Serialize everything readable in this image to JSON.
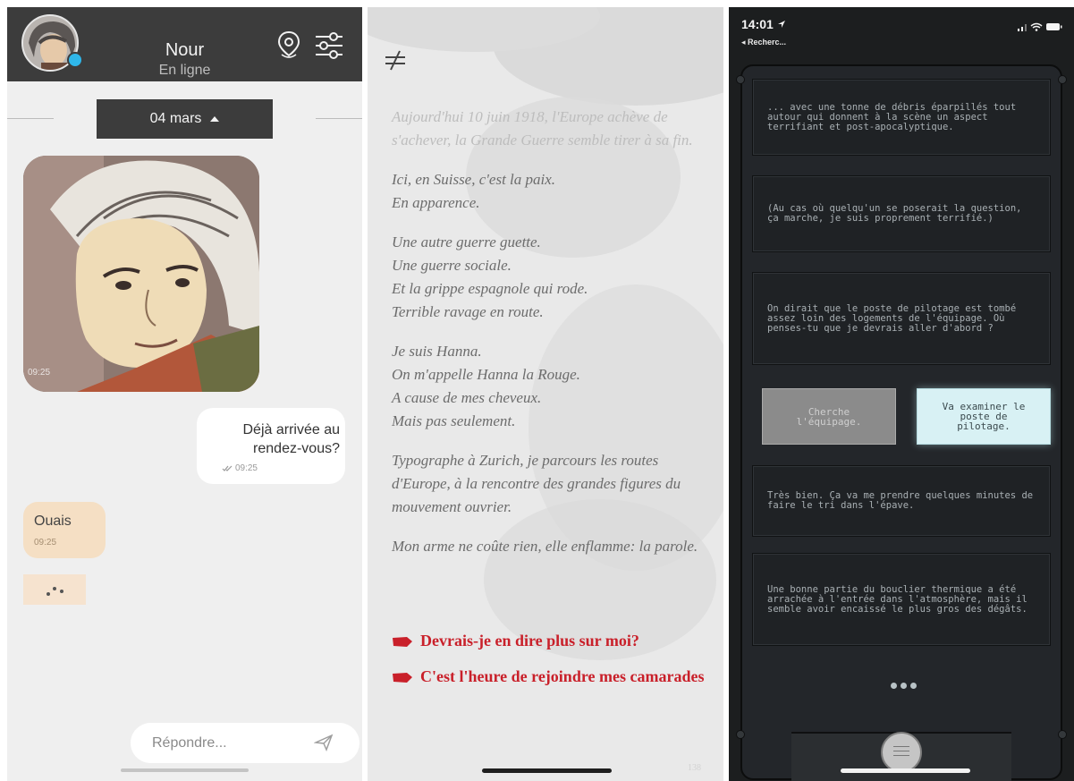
{
  "chat": {
    "contact_name": "Nour",
    "contact_status": "En ligne",
    "date_label": "04 mars",
    "photo_time": "09:25",
    "messages": [
      {
        "text": "Déjà arrivée au rendez-vous?",
        "time": "09:25"
      },
      {
        "text": "Ouais",
        "time": "09:25"
      }
    ],
    "reply_placeholder": "Répondre...",
    "colors": {
      "header": "#3c3c3c",
      "online": "#2fb7ea",
      "incoming": "#f5dfc4"
    },
    "icons": [
      "avatar",
      "location-pin-icon",
      "sliders-icon",
      "caret-up-icon",
      "read-check-icon",
      "typing-indicator",
      "send-icon"
    ]
  },
  "story": {
    "paragraphs": [
      "Aujourd'hui 10 juin 1918, l'Europe achève de s'achever, la Grande Guerre semble tirer à sa fin.",
      "Ici, en Suisse, c'est la paix.\nEn apparence.",
      "Une autre guerre guette.\nUne guerre sociale.\nEt la grippe espagnole qui rode.\nTerrible ravage en route.",
      "Je suis Hanna.\nOn m'appelle Hanna la Rouge.\nA cause de mes cheveux.\nMais pas seulement.",
      "Typographe à Zurich, je parcours les routes d'Europe, à la rencontre des grandes figures du mouvement ouvrier.",
      "Mon arme ne coûte rien, elle enflamme: la parole."
    ],
    "choices": [
      "Devrais-je en dire plus sur moi?",
      "C'est l'heure de rejoindre mes camarades"
    ],
    "page_number": "138",
    "colors": {
      "choice": "#c9202a"
    }
  },
  "game": {
    "status_time": "14:01",
    "back_label": "◂ Recherc...",
    "messages": [
      "... avec une tonne de débris éparpillés tout autour qui donnent à la scène un aspect terrifiant et post-apocalyptique.",
      "(Au cas où quelqu'un se poserait la question, ça marche, je suis proprement terrifié.)",
      "On dirait que le poste de pilotage est tombé assez loin des logements de l'équipage. Où penses-tu que je devrais aller d'abord ?",
      "Très bien. Ça va me prendre quelques minutes de faire le tri dans l'épave.",
      "Une bonne partie du bouclier thermique a été arrachée à l'entrée dans l'atmosphère, mais il semble avoir encaissé le plus gros des dégâts."
    ],
    "choice_a": "Cherche\nl'équipage.",
    "choice_b": "Va examiner le\nposte de\npilotage.",
    "colors": {
      "choice_b": "#d8f1f4",
      "choice_a": "#8b8b8b"
    }
  }
}
